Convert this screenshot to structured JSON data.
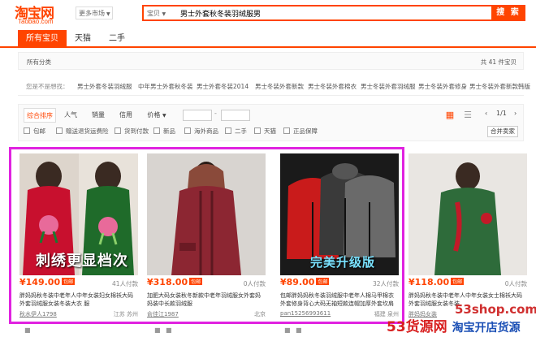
{
  "header": {
    "logo_text": "淘宝网",
    "logo_sub": "Taobao.com",
    "market_label": "更多市场",
    "search_category": "宝贝",
    "search_query": "男士外套秋冬装羽绒服男",
    "search_button": "搜 索"
  },
  "tabs": [
    "所有宝贝",
    "天猫",
    "二手"
  ],
  "breadcrumb": {
    "label": "所有分类",
    "count": "共 41 件宝贝"
  },
  "related": {
    "label": "您是不是想找：",
    "items": [
      "男士外套冬装羽绒服",
      "中年男士外套秋冬装",
      "男士外套冬装2014",
      "男士冬装外套新款",
      "男士冬装外套棉衣",
      "男士冬装外套羽绒服",
      "男士冬装外套修身",
      "男士冬装外套新款韩版"
    ]
  },
  "sort": {
    "items": [
      "综合排序",
      "人气",
      "销量",
      "信用",
      "价格"
    ],
    "price_dash": "-",
    "pager": "1/1"
  },
  "filters": [
    "包邮",
    "赠送退货运费险",
    "货到付款",
    "新品",
    "海外商品",
    "二手",
    "天猫",
    "正品保障"
  ],
  "merge_button": "合并卖家",
  "colors": {
    "accent": "#ff4400",
    "highlight": "#e022e0"
  },
  "products": [
    {
      "price": "¥149.00",
      "tag": "包邮",
      "paid": "41人付款",
      "title": "胖妈妈秋冬装中老年人中年女装妇女棉袄大码外套羽绒服女装冬装大衣 服",
      "shop": "秋水伊人1798",
      "loc": "江苏 苏州",
      "overlay": "刺绣更显档次"
    },
    {
      "price": "¥318.00",
      "tag": "包邮",
      "paid": "0人付款",
      "title": "加肥大码女装秋冬新款中老年羽绒服女外套妈妈装中长款羽绒服",
      "shop": "俞佳江1987",
      "loc": "北京",
      "overlay": ""
    },
    {
      "price": "¥89.00",
      "tag": "包邮",
      "paid": "32人付款",
      "title": "包邮胖妈妈秋冬装羽绒服中老年人棉马甲棉衣外套修身背心大码无袖短款连帽加厚外套坎肩",
      "shop": "pan15256993611",
      "loc": "福建 泉州",
      "overlay": "完美升级版"
    },
    {
      "price": "¥118.00",
      "tag": "包邮",
      "paid": "0人付款",
      "title": "胖妈妈秋冬装中老年人中年女装女士棉袄大码外套羽绒服女装冬装",
      "shop": "胖妈妈女装",
      "loc": "",
      "overlay": ""
    }
  ],
  "watermark": {
    "line1": "53shop.com",
    "line2a": "53货源网",
    "line2b": "淘宝开店货源"
  }
}
